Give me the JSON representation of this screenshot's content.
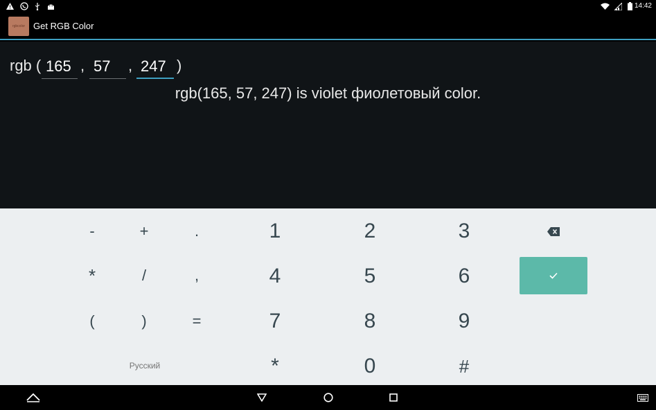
{
  "status_bar": {
    "time": "14:42",
    "icons": [
      "warning-icon",
      "viber-icon",
      "usb-icon",
      "android-icon",
      "wifi-icon",
      "signal-icon",
      "battery-icon"
    ]
  },
  "app_bar": {
    "logo_text": "rgbcolor",
    "title": "Get RGB Color"
  },
  "form": {
    "prefix": "rgb (",
    "comma1": ",",
    "comma2": ",",
    "suffix": ")",
    "r_value": "165",
    "g_value": "57",
    "b_value": "247"
  },
  "result": {
    "text": "rgb(165, 57, 247) is violet фиолетовый color."
  },
  "keyboard": {
    "row1": [
      "-",
      "+",
      ".",
      "1",
      "2",
      "3"
    ],
    "row2": [
      "*",
      "/",
      ",",
      "4",
      "5",
      "6"
    ],
    "row3": [
      "(",
      ")",
      "=",
      "7",
      "8",
      "9"
    ],
    "row4": [
      "*",
      "0",
      "#"
    ],
    "language": "Русский",
    "enter_color": "#5cb9a9"
  },
  "colors": {
    "accent": "#3e9fc1",
    "content_bg": "#101417",
    "keyboard_bg": "#eceff1"
  }
}
